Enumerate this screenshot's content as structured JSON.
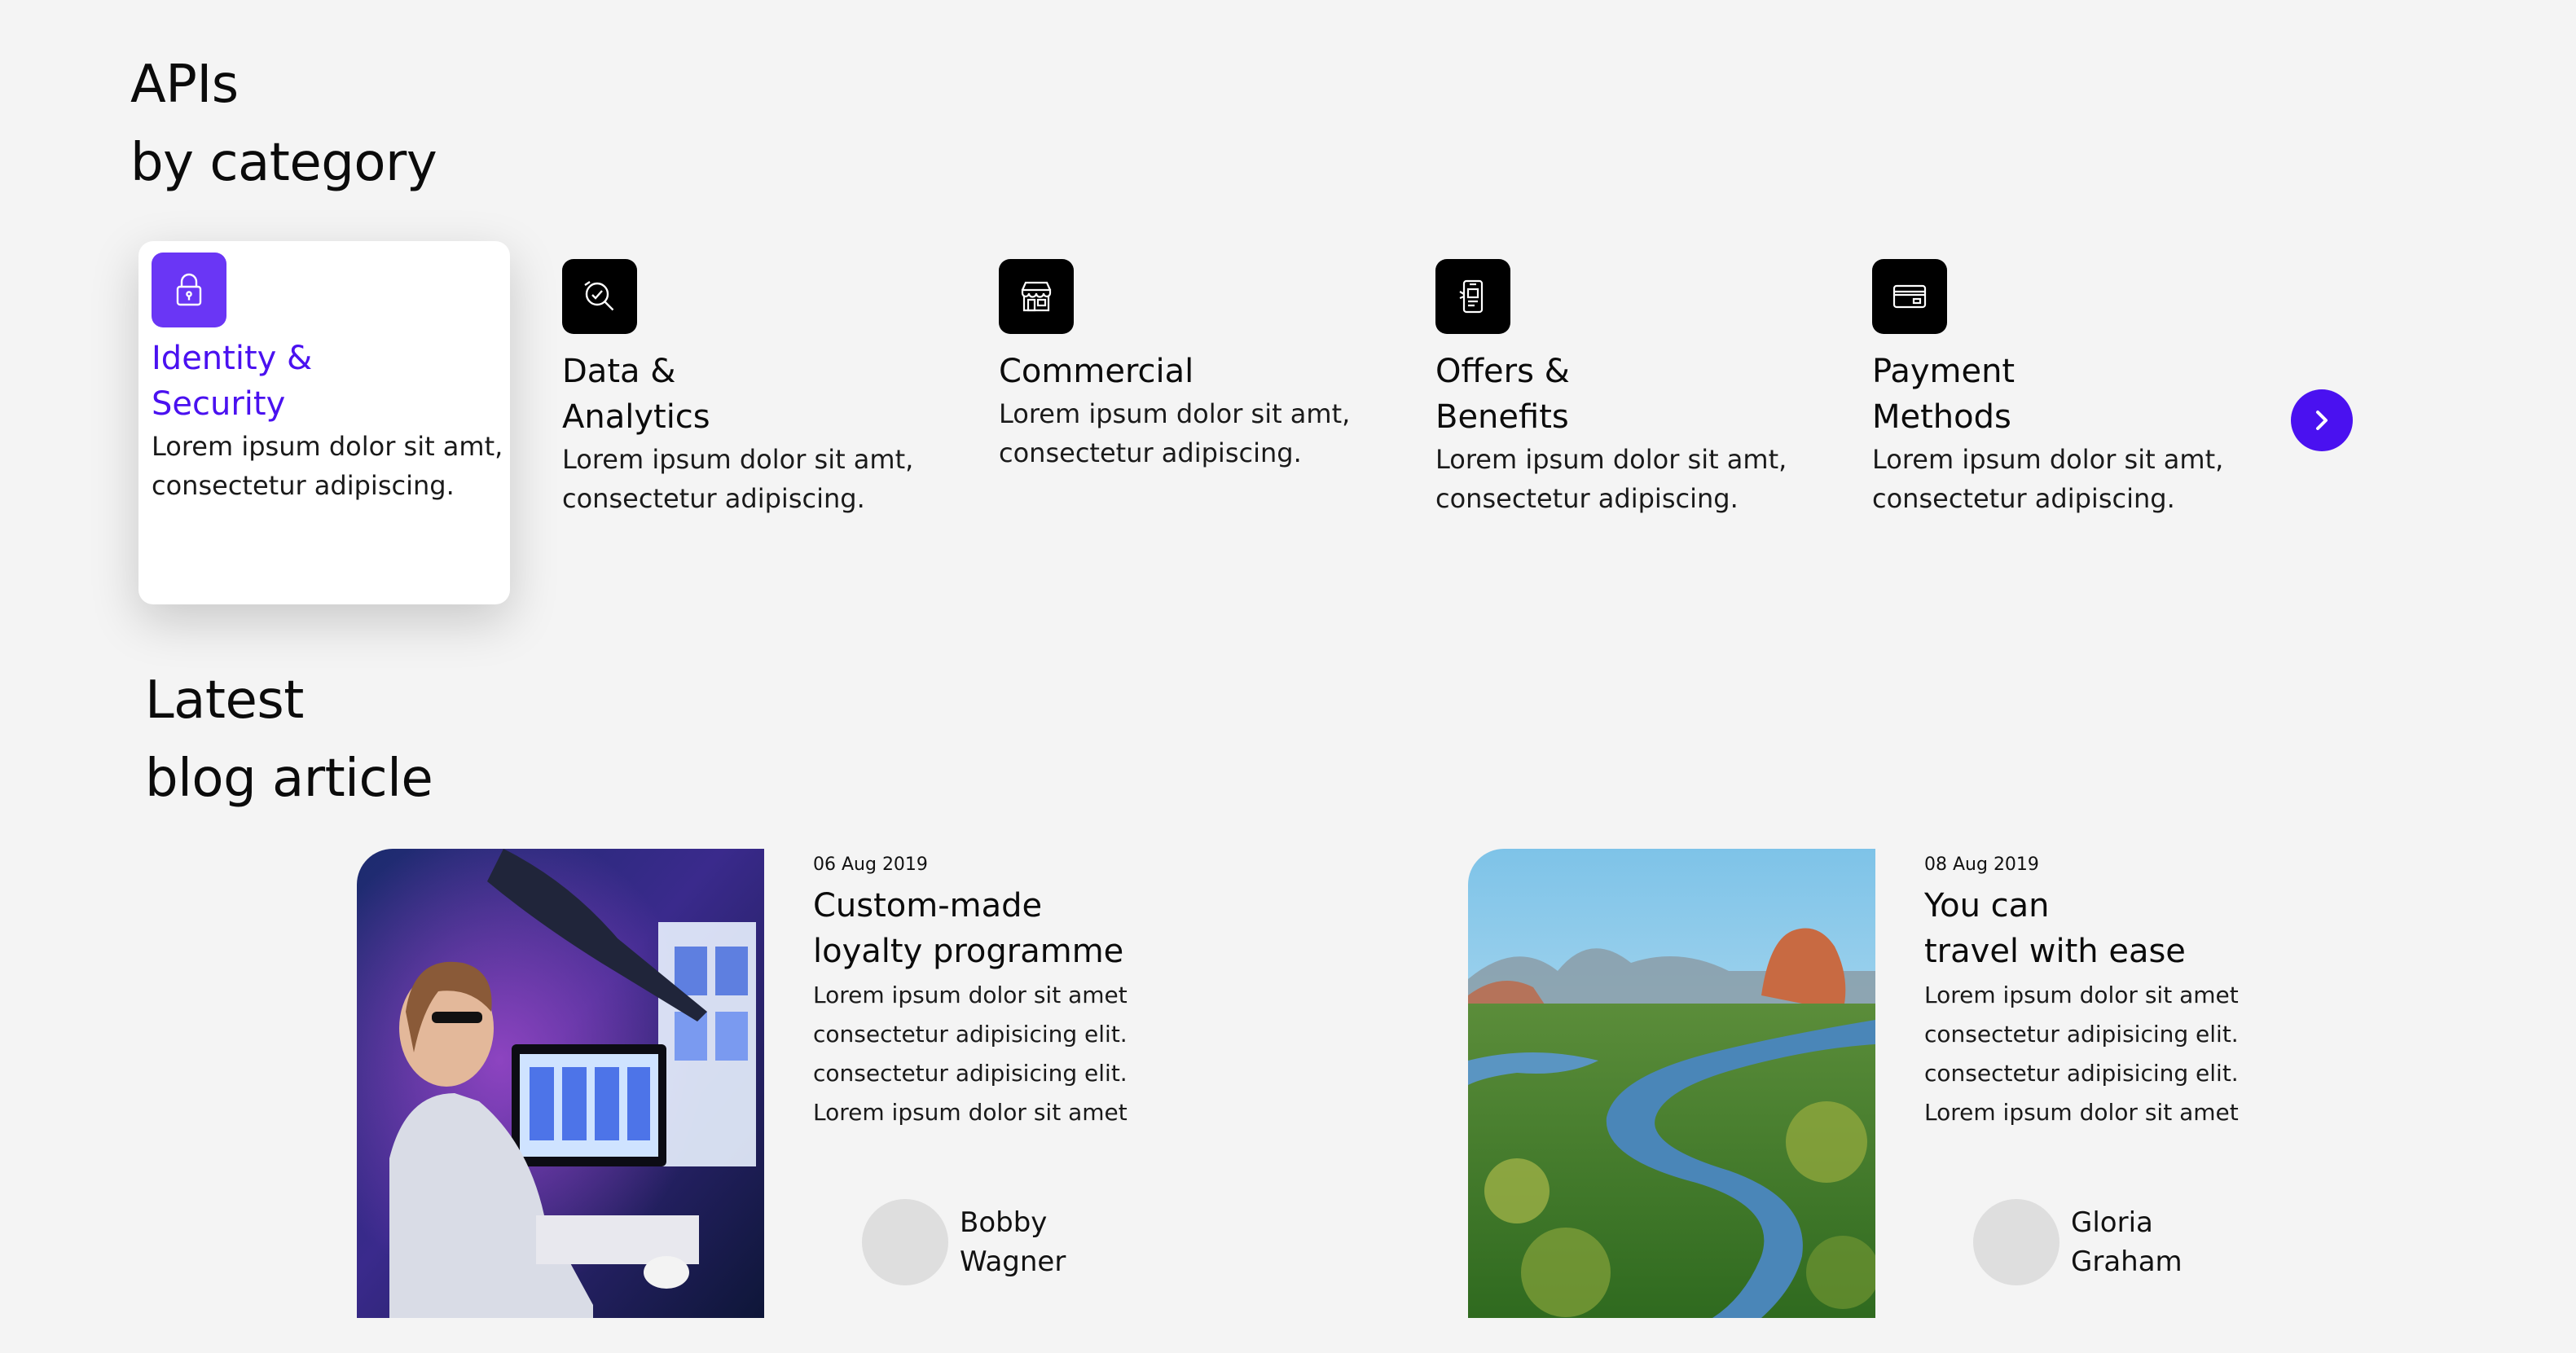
{
  "apis": {
    "title_line1": "APIs",
    "title_line2": "by category",
    "categories": [
      {
        "name_line1": "Identity &",
        "name_line2": "Security",
        "desc_line1": "Lorem ipsum dolor sit amt,",
        "desc_line2": "consectetur adipiscing.",
        "icon": "lock-icon",
        "active": true
      },
      {
        "name_line1": "Data &",
        "name_line2": "Analytics",
        "desc_line1": "Lorem ipsum dolor sit amt,",
        "desc_line2": "consectetur adipiscing.",
        "icon": "analytics-search-icon",
        "active": false
      },
      {
        "name_line1": "Commercial",
        "name_line2": "",
        "desc_line1": "Lorem ipsum dolor sit amt,",
        "desc_line2": "consectetur adipiscing.",
        "icon": "storefront-icon",
        "active": false
      },
      {
        "name_line1": "Offers &",
        "name_line2": "Benefits",
        "desc_line1": "Lorem ipsum dolor sit amt,",
        "desc_line2": "consectetur adipiscing.",
        "icon": "mobile-offer-icon",
        "active": false
      },
      {
        "name_line1": "Payment",
        "name_line2": "Methods",
        "desc_line1": "Lorem ipsum dolor sit amt,",
        "desc_line2": "consectetur adipiscing.",
        "icon": "credit-card-icon",
        "active": false
      }
    ],
    "next_icon": "chevron-right-icon"
  },
  "blog": {
    "title_line1": "Latest",
    "title_line2": "blog article",
    "posts": [
      {
        "date": "06 Aug 2019",
        "title_line1": "Custom-made",
        "title_line2": "loyalty programme",
        "excerpt": [
          "Lorem ipsum dolor sit amet",
          "consectetur adipisicing elit.",
          "consectetur adipisicing elit.",
          "Lorem ipsum dolor sit amet"
        ],
        "author_line1": "Bobby",
        "author_line2": "Wagner",
        "image": "person-at-computer-photo"
      },
      {
        "date": "08 Aug 2019",
        "title_line1": "You can",
        "title_line2": "travel with ease",
        "excerpt": [
          "Lorem ipsum dolor sit amet",
          "consectetur adipisicing elit.",
          "consectetur adipisicing elit.",
          "Lorem ipsum dolor sit amet"
        ],
        "author_line1": "Gloria",
        "author_line2": "Graham",
        "image": "river-landscape-photo"
      }
    ]
  },
  "colors": {
    "accent": "#4a11f0",
    "active_icon_bg": "#6a36f5",
    "icon_bg": "#000000",
    "page_bg": "#f4f4f4",
    "avatar_placeholder": "#dedede"
  }
}
